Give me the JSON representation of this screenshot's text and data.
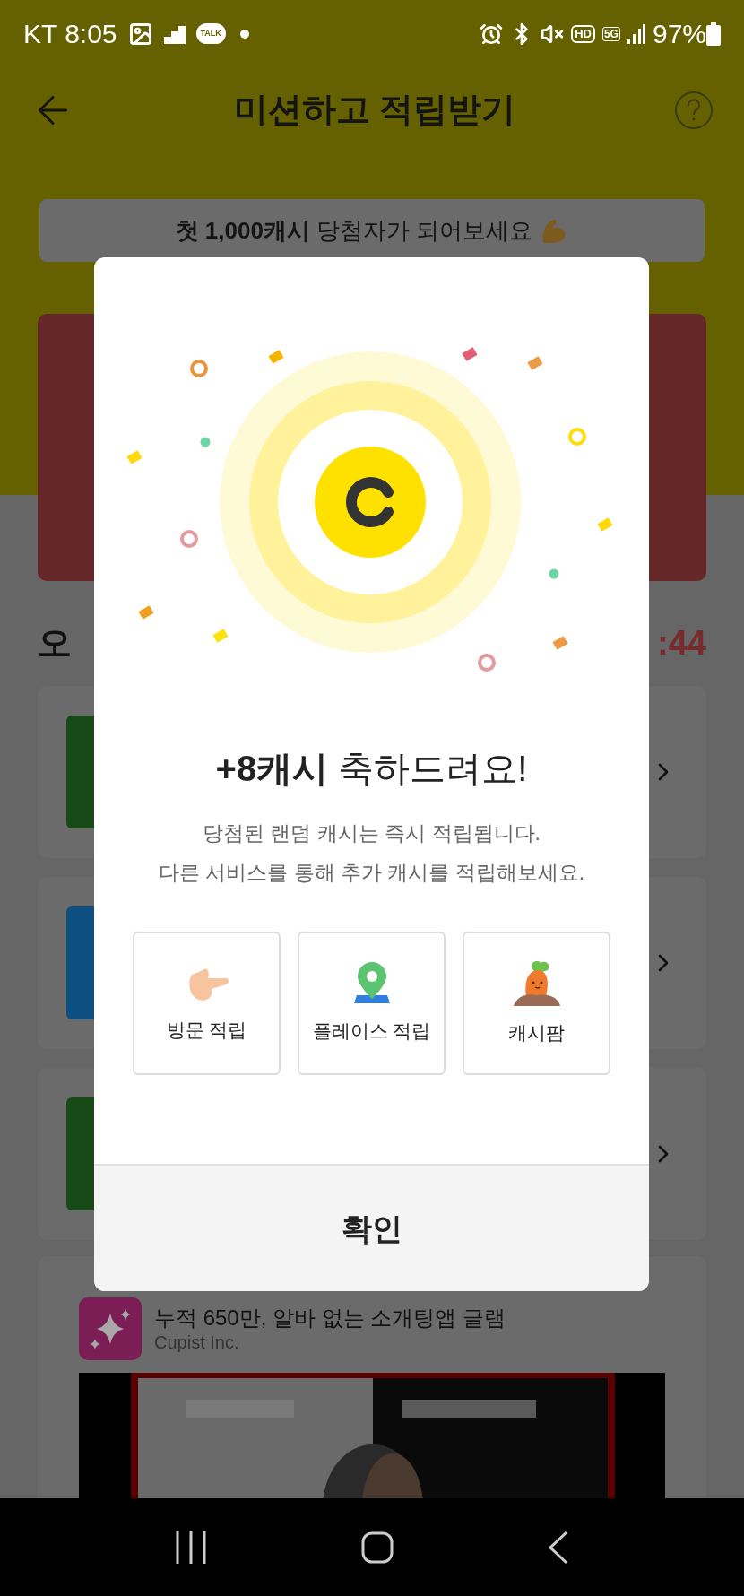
{
  "status_bar": {
    "carrier": "KT",
    "time": "8:05",
    "talk": "TALK",
    "hd": "HD",
    "network": "5G",
    "battery": "97%"
  },
  "header": {
    "title": "미션하고 적립받기"
  },
  "banner": {
    "text": "**첫 1,000캐시** 당첨자가 되어보세요"
  },
  "section": {
    "title": "오",
    "timer": ":44"
  },
  "missions": [
    {
      "color": "#174a17"
    },
    {
      "color": "#0d4f80"
    },
    {
      "color": "#174a17"
    }
  ],
  "ad": {
    "title": "누적 650만, 알바 없는 소개팅앱 글램",
    "advertiser": "Cupist Inc."
  },
  "modal": {
    "title": "**+8캐시** 축하드려요!",
    "message": [
      "당첨된 랜덤 캐시는 즉시 적립됩니다.",
      "다른 서비스를 통해 추가 캐시를 적립해보세요."
    ],
    "services": [
      {
        "kind": "visit",
        "label": "방문 적립"
      },
      {
        "kind": "place",
        "label": "플레이스 적립"
      },
      {
        "kind": "farm",
        "label": "캐시팜"
      }
    ],
    "confirm": "확인"
  }
}
